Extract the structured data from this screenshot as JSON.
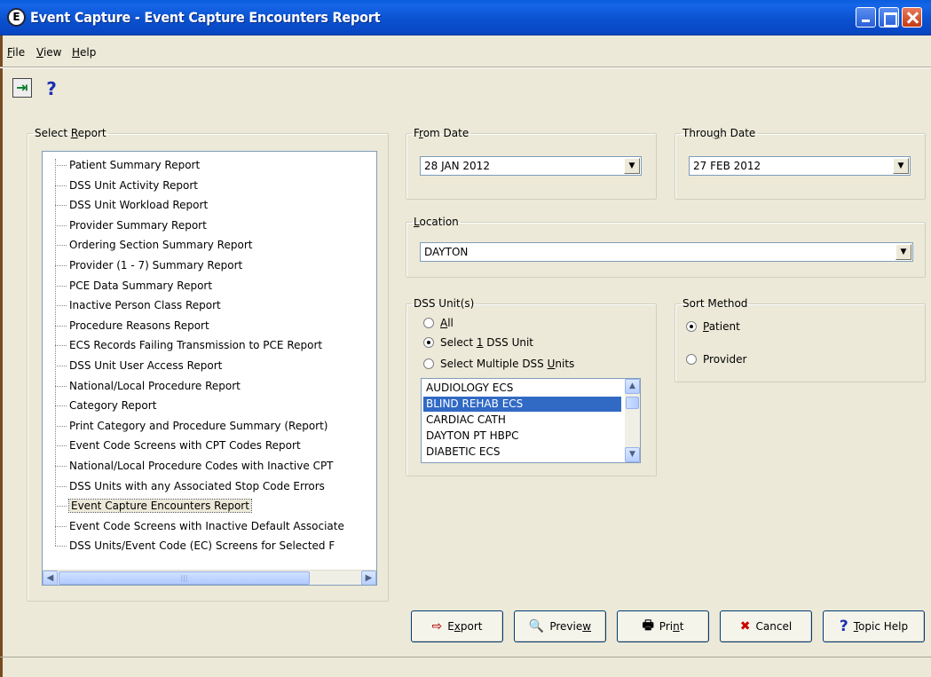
{
  "window": {
    "app_icon_letter": "E",
    "title": "Event Capture - Event Capture Encounters Report"
  },
  "menu": [
    {
      "first": "F",
      "rest": "ile"
    },
    {
      "first": "V",
      "rest": "iew"
    },
    {
      "first": "H",
      "rest": "elp"
    }
  ],
  "toolbar": {
    "exit_glyph": "⇥",
    "help_glyph": "?"
  },
  "select_report": {
    "legend_pre": "Select ",
    "legend_u": "R",
    "legend_post": "eport",
    "items": [
      "Patient Summary Report",
      "DSS Unit Activity Report",
      "DSS Unit Workload Report",
      "Provider Summary Report",
      "Ordering Section Summary Report",
      "Provider (1 - 7) Summary Report",
      "PCE Data Summary Report",
      "Inactive Person Class Report",
      "Procedure Reasons Report",
      "ECS Records Failing Transmission to PCE Report",
      "DSS Unit User Access Report",
      "National/Local Procedure Report",
      "Category Report",
      "Print Category and Procedure Summary (Report)",
      "Event Code Screens with CPT Codes Report",
      "National/Local Procedure Codes with Inactive CPT",
      "DSS Units with any Associated Stop Code Errors",
      "Event Capture Encounters Report",
      "Event Code Screens with Inactive Default Associate",
      "DSS Units/Event Code (EC) Screens for Selected F"
    ],
    "selected_index": 17
  },
  "from_date": {
    "legend_pre": "F",
    "legend_u": "r",
    "legend_post": "om Date",
    "value": "28 JAN 2012"
  },
  "through_date": {
    "legend_pre": "Throu",
    "legend_u": "g",
    "legend_post": "h Date",
    "value": "27 FEB 2012"
  },
  "location": {
    "legend_u": "L",
    "legend_post": "ocation",
    "value": "DAYTON"
  },
  "dss_units": {
    "legend": "DSS Unit(s)",
    "options": [
      {
        "pre": "",
        "u": "A",
        "post": "ll",
        "checked": false
      },
      {
        "pre": "Select ",
        "u": "1",
        "post": " DSS Unit",
        "checked": true
      },
      {
        "pre": "Select Multiple DSS ",
        "u": "U",
        "post": "nits",
        "checked": false
      }
    ],
    "list": [
      "AUDIOLOGY ECS",
      "BLIND REHAB ECS",
      "CARDIAC CATH",
      "DAYTON PT HBPC",
      "DIABETIC ECS"
    ],
    "list_selected": 1
  },
  "sort_method": {
    "legend": "Sort Method",
    "options": [
      {
        "u": "P",
        "post": "atient",
        "checked": true
      },
      {
        "u": "",
        "post": "Provider",
        "checked": false
      }
    ]
  },
  "buttons": [
    {
      "icon": "⇨",
      "pre": "E",
      "u": "x",
      "post": "port"
    },
    {
      "icon": "🔍",
      "pre": "Previe",
      "u": "w",
      "post": ""
    },
    {
      "icon": "🖶",
      "pre": "Pri",
      "u": "n",
      "post": "t"
    },
    {
      "icon": "✖",
      "pre": "Cancel",
      "u": "",
      "post": ""
    },
    {
      "icon": "?",
      "pre": "",
      "u": "T",
      "post": "opic Help"
    }
  ],
  "colors": {
    "titlebar": "#0b52d0",
    "dialog_bg": "#ece9d8",
    "selection": "#316ac5",
    "cancel_icon": "#cc0000",
    "help_icon": "#1c2fb2"
  }
}
